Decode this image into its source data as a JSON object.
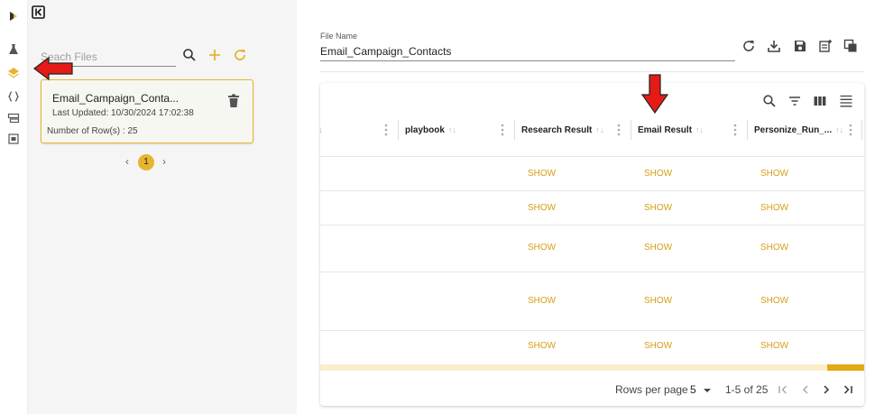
{
  "rail": {
    "items": [
      {
        "icon": "play-icon",
        "active": false
      },
      {
        "icon": "flask-icon",
        "active": false
      },
      {
        "icon": "layers-icon",
        "active": true
      },
      {
        "icon": "code-braces-icon",
        "active": false
      },
      {
        "icon": "list-icon",
        "active": false
      },
      {
        "icon": "dataset-icon",
        "active": false
      }
    ],
    "collapse_icon": "collapse-sidebar-icon"
  },
  "sidebar": {
    "search": {
      "placeholder": "Seach Files",
      "value": ""
    },
    "file": {
      "name": "Email_Campaign_Conta...",
      "updated": "Last Updated: 10/30/2024 17:02:38",
      "rows": "Number of Row(s) : 25"
    },
    "pagination": {
      "prev": "‹",
      "current": "1",
      "next": "›"
    }
  },
  "main": {
    "file_name_label": "File Name",
    "file_name_value": "Email_Campaign_Contacts",
    "toolbar_icons": [
      "refresh-icon",
      "download-icon",
      "save-icon",
      "add-playlist-icon",
      "copy-icon"
    ]
  },
  "grid": {
    "toolbar_icons": [
      "search-icon",
      "filter-icon",
      "columns-icon",
      "density-icon"
    ],
    "columns": [
      "playbook",
      "Research Result",
      "Email Result",
      "Personize_Run_..."
    ],
    "rows": [
      {
        "research": "SHOW",
        "email": "SHOW",
        "personize": "SHOW"
      },
      {
        "research": "SHOW",
        "email": "SHOW",
        "personize": "SHOW"
      },
      {
        "research": "SHOW",
        "email": "SHOW",
        "personize": "SHOW"
      },
      {
        "research": "SHOW",
        "email": "SHOW",
        "personize": "SHOW"
      },
      {
        "research": "SHOW",
        "email": "SHOW",
        "personize": "SHOW"
      }
    ],
    "footer": {
      "rows_per_page_label": "Rows per page",
      "rows_per_page_value": "5",
      "range": "1-5 of 25"
    }
  },
  "colors": {
    "accent": "#e8b430",
    "show_text": "#d4a017",
    "annotation": "#e41b17"
  }
}
